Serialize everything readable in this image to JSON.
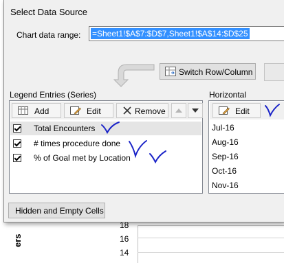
{
  "dialog": {
    "title": "Select Data Source",
    "chart_range": {
      "label": "Chart data range:",
      "value": "=Sheet1!$A$7:$D$7,Sheet1!$A$14:$D$25"
    },
    "switch_button": "Switch Row/Column",
    "legend": {
      "label": "Legend Entries (Series)",
      "add": "Add",
      "edit": "Edit",
      "remove": "Remove",
      "items": [
        {
          "label": "Total Encounters",
          "checked": true
        },
        {
          "label": "# times procedure done",
          "checked": true
        },
        {
          "label": "% of Goal met by Location",
          "checked": true
        }
      ]
    },
    "category": {
      "label": "Horizontal (Category)",
      "edit": "Edit",
      "items": [
        "Jul-16",
        "Aug-16",
        "Sep-16",
        "Oct-16",
        "Nov-16"
      ]
    },
    "hidden_button": "Hidden and Empty Cells"
  },
  "background": {
    "ticks": [
      "18",
      "16",
      "14"
    ],
    "axis_label_fragment": "ers"
  },
  "colors": {
    "ink": "#1a23c8",
    "selection": "#3390ff"
  }
}
